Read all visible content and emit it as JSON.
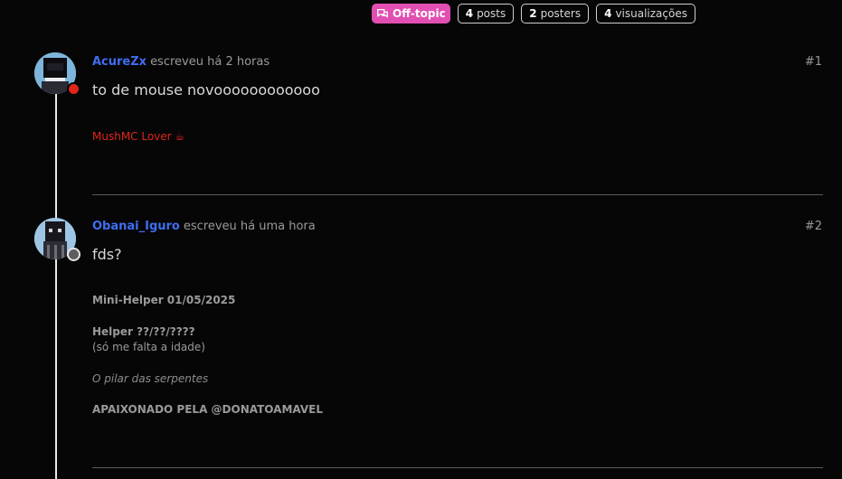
{
  "topic": {
    "category": "Off-topic",
    "posts_count": "4",
    "posts_label": "posts",
    "posters_count": "2",
    "posters_label": "posters",
    "views_count": "4",
    "views_label": "visualizações"
  },
  "posts": [
    {
      "username": "AcureZx",
      "meta": "escreveu há 2 horas",
      "number": "#1",
      "content": "to de mouse novoooooooooooo",
      "signature": {
        "text": "MushMC Lover ☕",
        "color": "#e0251b"
      },
      "status_color": "#e0251b"
    },
    {
      "username": "Obanai_Iguro",
      "meta": "escreveu há uma hora",
      "number": "#2",
      "content": "fds?",
      "signature_lines": {
        "line1": "Mini-Helper 01/05/2025",
        "line2": "Helper ??/??/????",
        "line3": "(só me falta a idade)",
        "line4": "O pilar das serpentes",
        "line5": "APAIXONADO PELA @DONATOAMAVEL"
      },
      "status_color": "#5e5e5e"
    }
  ],
  "colors": {
    "accent": "#3f6ef0",
    "category": "#e24fb2"
  }
}
